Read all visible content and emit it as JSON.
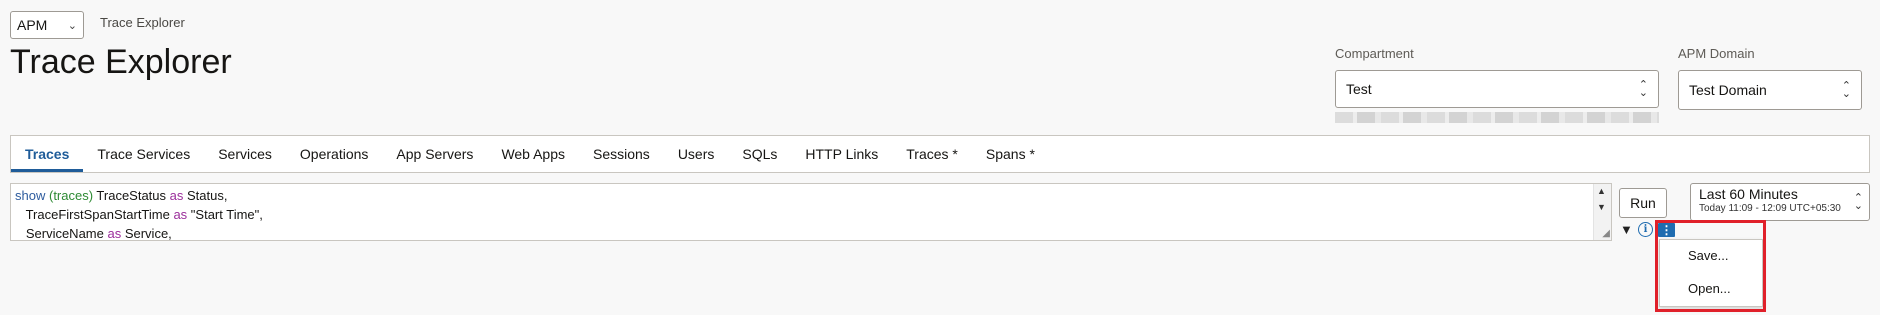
{
  "header": {
    "app_select": "APM",
    "breadcrumb": "Trace Explorer",
    "title": "Trace Explorer"
  },
  "compartment": {
    "label": "Compartment",
    "value": "Test"
  },
  "apm_domain": {
    "label": "APM Domain",
    "value": "Test Domain"
  },
  "tabs": [
    {
      "label": "Traces",
      "active": true
    },
    {
      "label": "Trace Services"
    },
    {
      "label": "Services"
    },
    {
      "label": "Operations"
    },
    {
      "label": "App Servers"
    },
    {
      "label": "Web Apps"
    },
    {
      "label": "Sessions"
    },
    {
      "label": "Users"
    },
    {
      "label": "SQLs"
    },
    {
      "label": "HTTP Links"
    },
    {
      "label": "Traces *"
    },
    {
      "label": "Spans *"
    }
  ],
  "query": {
    "line1": {
      "show": "show",
      "traces": "(traces)",
      "field": " TraceStatus ",
      "as": "as",
      "alias": " Status,"
    },
    "line2": {
      "field": "   TraceFirstSpanStartTime ",
      "as": "as",
      "alias": " \"Start Time\","
    },
    "line3": {
      "field": "   ServiceName ",
      "as": "as",
      "alias": " Service,"
    }
  },
  "run_label": "Run",
  "time_range": {
    "label": "Last 60 Minutes",
    "detail": "Today 11:09 - 12:09 UTC+05:30"
  },
  "actions_menu": {
    "save": "Save...",
    "open": "Open..."
  },
  "colors": {
    "accent": "#1f6cb0",
    "highlight": "#e0202a",
    "keyword_blue": "#2e5c9e",
    "keyword_green": "#2d8a33",
    "keyword_purple": "#9b2e9b"
  },
  "icons": [
    "chevron-down-icon",
    "sort-updown-icon",
    "info-icon",
    "more-vertical-icon",
    "collapse-triangle-icon"
  ]
}
